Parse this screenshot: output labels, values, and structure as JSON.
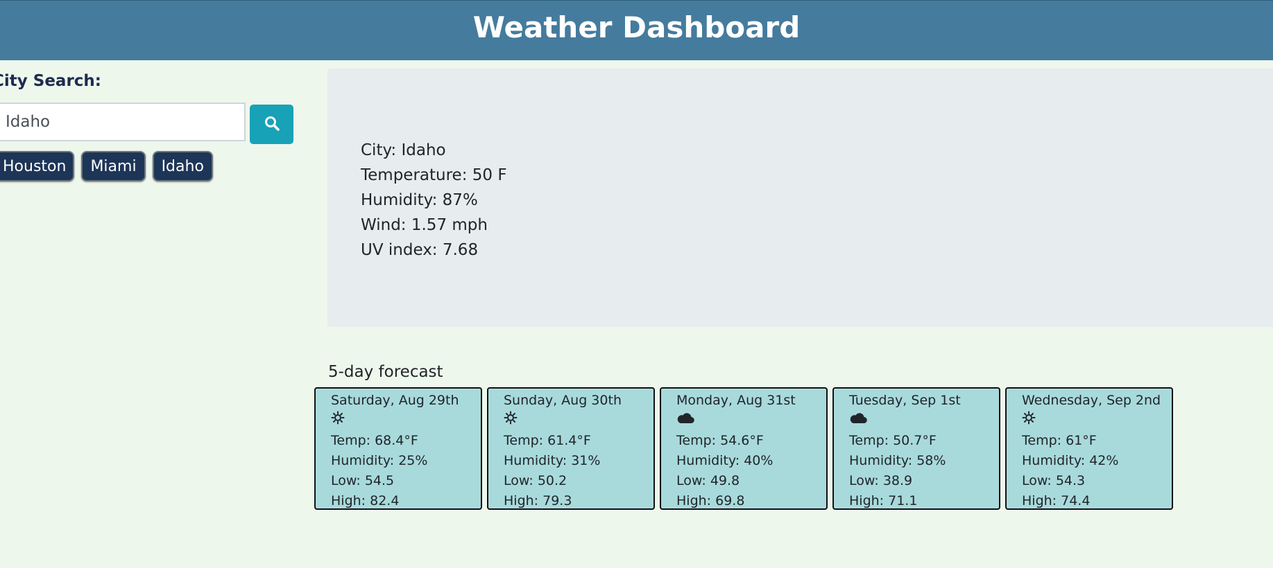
{
  "header": {
    "title": "Weather Dashboard"
  },
  "search": {
    "label": "City Search:",
    "value": "Idaho",
    "button_icon": "search-icon"
  },
  "history": [
    "Houston",
    "Miami",
    "Idaho"
  ],
  "current": {
    "city": "City: Idaho",
    "temperature": "Temperature: 50 F",
    "humidity": "Humidity: 87%",
    "wind": "Wind: 1.57 mph",
    "uv": "UV index: 7.68"
  },
  "forecast": {
    "heading": "5-day forecast",
    "days": [
      {
        "date": "Saturday, Aug 29th",
        "icon": "sun-icon",
        "temp": "Temp: 68.4°F",
        "humidity": "Humidity: 25%",
        "low": "Low: 54.5",
        "high": "High: 82.4"
      },
      {
        "date": "Sunday, Aug 30th",
        "icon": "sun-icon",
        "temp": "Temp: 61.4°F",
        "humidity": "Humidity: 31%",
        "low": "Low: 50.2",
        "high": "High: 79.3"
      },
      {
        "date": "Monday, Aug 31st",
        "icon": "cloud-icon",
        "temp": "Temp: 54.6°F",
        "humidity": "Humidity: 40%",
        "low": "Low: 49.8",
        "high": "High: 69.8"
      },
      {
        "date": "Tuesday, Sep 1st",
        "icon": "cloud-icon",
        "temp": "Temp: 50.7°F",
        "humidity": "Humidity: 58%",
        "low": "Low: 38.9",
        "high": "High: 71.1"
      },
      {
        "date": "Wednesday, Sep 2nd",
        "icon": "sun-icon",
        "temp": "Temp: 61°F",
        "humidity": "Humidity: 42%",
        "low": "Low: 54.3",
        "high": "High: 74.4"
      }
    ]
  },
  "colors": {
    "header_bg": "#457b9d",
    "page_bg": "#eef7ec",
    "search_button_bg": "#17a2b8",
    "history_button_bg": "#1d3557",
    "current_panel_bg": "#e7ecee",
    "forecast_card_bg": "#a8dadc"
  }
}
